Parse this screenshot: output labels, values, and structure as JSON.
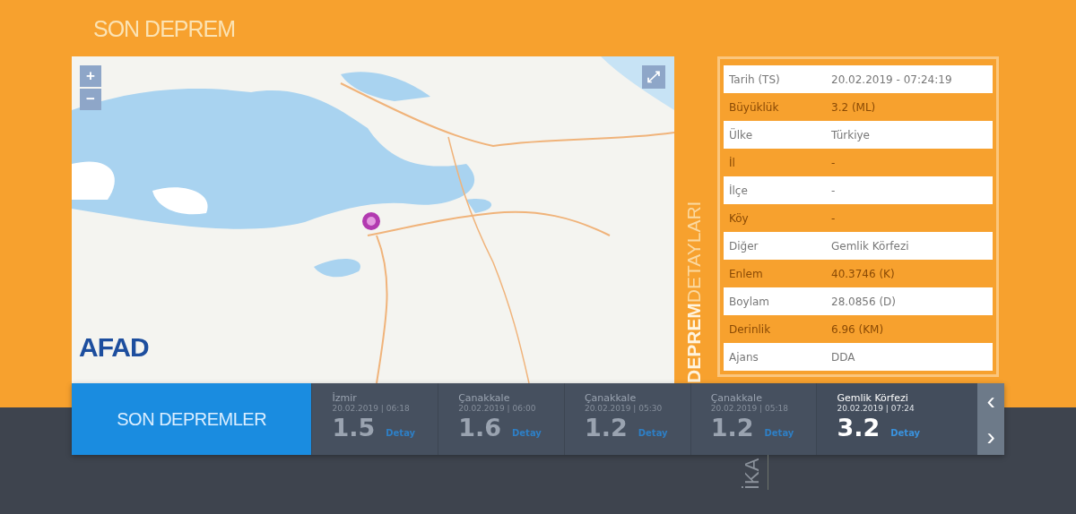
{
  "header": {
    "title": "SON DEPREM"
  },
  "map": {
    "zoom_in": "+",
    "zoom_out": "−",
    "fullscreen": "⤢",
    "logo": "AFAD"
  },
  "details": {
    "title_bold": "DEPREM",
    "title_light": "DETAYLARI",
    "rows": [
      {
        "label": "Tarih (TS)",
        "value": "20.02.2019 - 07:24:19"
      },
      {
        "label": "Büyüklük",
        "value": "3.2 (ML)"
      },
      {
        "label": "Ülke",
        "value": "Türkiye"
      },
      {
        "label": "İl",
        "value": "-"
      },
      {
        "label": "İlçe",
        "value": "-"
      },
      {
        "label": "Köy",
        "value": "-"
      },
      {
        "label": "Diğer",
        "value": "Gemlik Körfezi"
      },
      {
        "label": "Enlem",
        "value": "40.3746 (K)"
      },
      {
        "label": "Boylam",
        "value": "28.0856 (D)"
      },
      {
        "label": "Derinlik",
        "value": "6.96 (KM)"
      },
      {
        "label": "Ajans",
        "value": "DDA"
      }
    ]
  },
  "recent": {
    "title": "SON DEPREMLER",
    "items": [
      {
        "place": "İzmir",
        "date": "20.02.2019 | 06:18",
        "magnitude": "1.5",
        "link": "Detay",
        "selected": false
      },
      {
        "place": "Çanakkale",
        "date": "20.02.2019 | 06:00",
        "magnitude": "1.6",
        "link": "Detay",
        "selected": false
      },
      {
        "place": "Çanakkale",
        "date": "20.02.2019 | 05:30",
        "magnitude": "1.2",
        "link": "Detay",
        "selected": false
      },
      {
        "place": "Çanakkale",
        "date": "20.02.2019 | 05:18",
        "magnitude": "1.2",
        "link": "Detay",
        "selected": false
      },
      {
        "place": "Gemlik Körfezi",
        "date": "20.02.2019 | 07:24",
        "magnitude": "3.2",
        "link": "Detay",
        "selected": true
      }
    ],
    "prev": "‹",
    "next": "›"
  },
  "footer": {
    "vertical_label": "İKA"
  }
}
